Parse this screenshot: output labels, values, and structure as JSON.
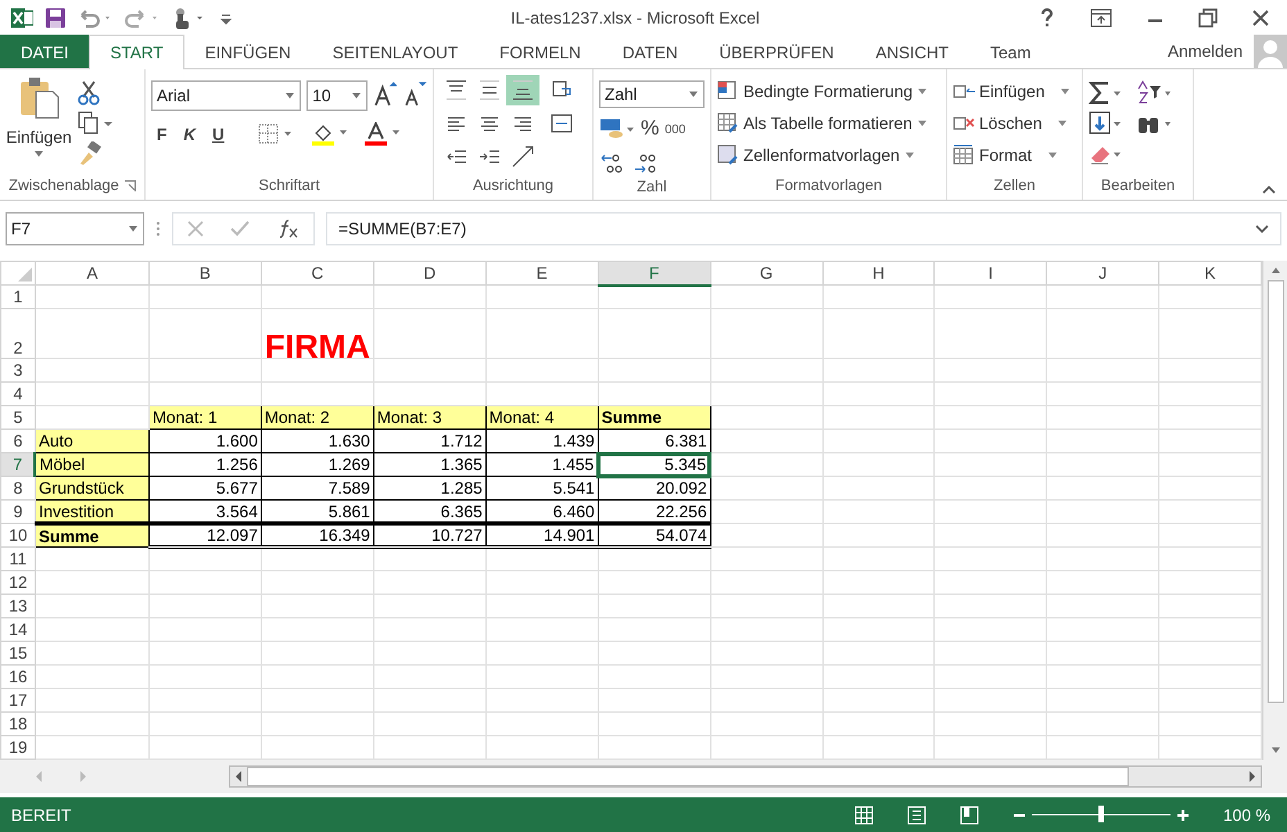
{
  "title_bar": {
    "title": "IL-ates1237.xlsx - Microsoft Excel"
  },
  "tabs": [
    {
      "label": "DATEI",
      "kind": "file",
      "selected": false
    },
    {
      "label": "START",
      "kind": "tab",
      "selected": true
    },
    {
      "label": "EINFÜGEN",
      "kind": "tab",
      "selected": false
    },
    {
      "label": "SEITENLAYOUT",
      "kind": "tab",
      "selected": false
    },
    {
      "label": "FORMELN",
      "kind": "tab",
      "selected": false
    },
    {
      "label": "DATEN",
      "kind": "tab",
      "selected": false
    },
    {
      "label": "ÜBERPRÜFEN",
      "kind": "tab",
      "selected": false
    },
    {
      "label": "ANSICHT",
      "kind": "tab",
      "selected": false
    },
    {
      "label": "Team",
      "kind": "tab",
      "selected": false
    }
  ],
  "account": {
    "label": "Anmelden"
  },
  "ribbon": {
    "clipboard": {
      "paste_label": "Einfügen",
      "group_label": "Zwischenablage"
    },
    "font": {
      "family": "Arial",
      "size": "10",
      "style_buttons": [
        "F",
        "K",
        "U"
      ],
      "group_label": "Schriftart"
    },
    "alignment": {
      "buttons": [
        {
          "selected": false
        },
        {
          "selected": false
        },
        {
          "selected": true
        },
        {
          "selected": false
        },
        {
          "selected": false
        },
        {
          "selected": false
        },
        {
          "selected": false
        },
        {
          "selected": false
        },
        {
          "selected": false
        },
        {
          "selected": false
        },
        {
          "selected": false
        }
      ],
      "group_label": "Ausrichtung"
    },
    "number": {
      "format": "Zahl",
      "percent": "%",
      "thousands": "000",
      "group_label": "Zahl"
    },
    "styles": {
      "items": [
        "Bedingte Formatierung",
        "Als Tabelle formatieren",
        "Zellenformatvorlagen"
      ],
      "group_label": "Formatvorlagen"
    },
    "cells": {
      "items": [
        "Einfügen",
        "Löschen",
        "Format"
      ],
      "group_label": "Zellen"
    },
    "editing": {
      "group_label": "Bearbeiten"
    }
  },
  "formula_bar": {
    "name_box": "F7",
    "formula": "=SUMME(B7:E7)"
  },
  "sheet": {
    "columns": [
      {
        "label": "A",
        "selected": false
      },
      {
        "label": "B",
        "selected": false
      },
      {
        "label": "C",
        "selected": false
      },
      {
        "label": "D",
        "selected": false
      },
      {
        "label": "E",
        "selected": false
      },
      {
        "label": "F",
        "selected": true
      },
      {
        "label": "G",
        "selected": false
      },
      {
        "label": "H",
        "selected": false
      },
      {
        "label": "I",
        "selected": false
      },
      {
        "label": "J",
        "selected": false
      },
      {
        "label": "K",
        "selected": false
      }
    ],
    "rows": [
      {
        "label": "1",
        "selected": false
      },
      {
        "label": "2",
        "selected": false,
        "tall": true,
        "cells": [
          {
            "kind": "empty",
            "selected": false
          },
          {
            "kind": "empty",
            "selected": false
          },
          {
            "kind": "title",
            "text": "FIRMA",
            "selected": false
          }
        ]
      },
      {
        "label": "3",
        "selected": false
      },
      {
        "label": "4",
        "selected": false
      },
      {
        "label": "5",
        "selected": false,
        "cells": [
          {
            "kind": "empty",
            "selected": false
          },
          {
            "kind": "header",
            "text": "Monat: 1",
            "selected": false
          },
          {
            "kind": "header",
            "text": "Monat: 2",
            "selected": false
          },
          {
            "kind": "header",
            "text": "Monat: 3",
            "selected": false
          },
          {
            "kind": "header",
            "text": "Monat: 4",
            "selected": false
          },
          {
            "kind": "header-total",
            "text": "Summe",
            "selected": false
          }
        ]
      },
      {
        "label": "6",
        "selected": false,
        "cells": [
          {
            "kind": "label",
            "text": "Auto",
            "selected": false
          },
          {
            "kind": "number",
            "text": "1.600",
            "selected": false
          },
          {
            "kind": "number",
            "text": "1.630",
            "selected": false
          },
          {
            "kind": "number",
            "text": "1.712",
            "selected": false
          },
          {
            "kind": "number",
            "text": "1.439",
            "selected": false
          },
          {
            "kind": "number",
            "text": "6.381",
            "selected": false
          }
        ]
      },
      {
        "label": "7",
        "selected": true,
        "cells": [
          {
            "kind": "label",
            "text": "Möbel",
            "selected": false
          },
          {
            "kind": "number",
            "text": "1.256",
            "selected": false
          },
          {
            "kind": "number",
            "text": "1.269",
            "selected": false
          },
          {
            "kind": "number",
            "text": "1.365",
            "selected": false
          },
          {
            "kind": "number",
            "text": "1.455",
            "selected": false
          },
          {
            "kind": "number",
            "text": "5.345",
            "selected": true
          }
        ]
      },
      {
        "label": "8",
        "selected": false,
        "cells": [
          {
            "kind": "label",
            "text": "Grundstück",
            "selected": false
          },
          {
            "kind": "number",
            "text": "5.677",
            "selected": false
          },
          {
            "kind": "number",
            "text": "7.589",
            "selected": false
          },
          {
            "kind": "number",
            "text": "1.285",
            "selected": false
          },
          {
            "kind": "number",
            "text": "5.541",
            "selected": false
          },
          {
            "kind": "number",
            "text": "20.092",
            "selected": false
          }
        ]
      },
      {
        "label": "9",
        "selected": false,
        "cells": [
          {
            "kind": "label",
            "text": "Investition",
            "selected": false
          },
          {
            "kind": "number",
            "text": "3.564",
            "selected": false
          },
          {
            "kind": "number",
            "text": "5.861",
            "selected": false
          },
          {
            "kind": "number",
            "text": "6.365",
            "selected": false
          },
          {
            "kind": "number",
            "text": "6.460",
            "selected": false
          },
          {
            "kind": "number",
            "text": "22.256",
            "selected": false
          }
        ]
      },
      {
        "label": "10",
        "selected": false,
        "cells": [
          {
            "kind": "total-label",
            "text": "Summe",
            "selected": false
          },
          {
            "kind": "total",
            "text": "12.097",
            "selected": false
          },
          {
            "kind": "total",
            "text": "16.349",
            "selected": false
          },
          {
            "kind": "total",
            "text": "10.727",
            "selected": false
          },
          {
            "kind": "total",
            "text": "14.901",
            "selected": false
          },
          {
            "kind": "total",
            "text": "54.074",
            "selected": false
          }
        ]
      },
      {
        "label": "11",
        "selected": false
      },
      {
        "label": "12",
        "selected": false
      },
      {
        "label": "13",
        "selected": false
      },
      {
        "label": "14",
        "selected": false
      },
      {
        "label": "15",
        "selected": false
      },
      {
        "label": "16",
        "selected": false
      },
      {
        "label": "17",
        "selected": false
      },
      {
        "label": "18",
        "selected": false
      },
      {
        "label": "19",
        "selected": false
      }
    ]
  },
  "status_bar": {
    "status": "BEREIT",
    "zoom": "100 %",
    "zoom_slider": {
      "level": 0.5
    }
  }
}
